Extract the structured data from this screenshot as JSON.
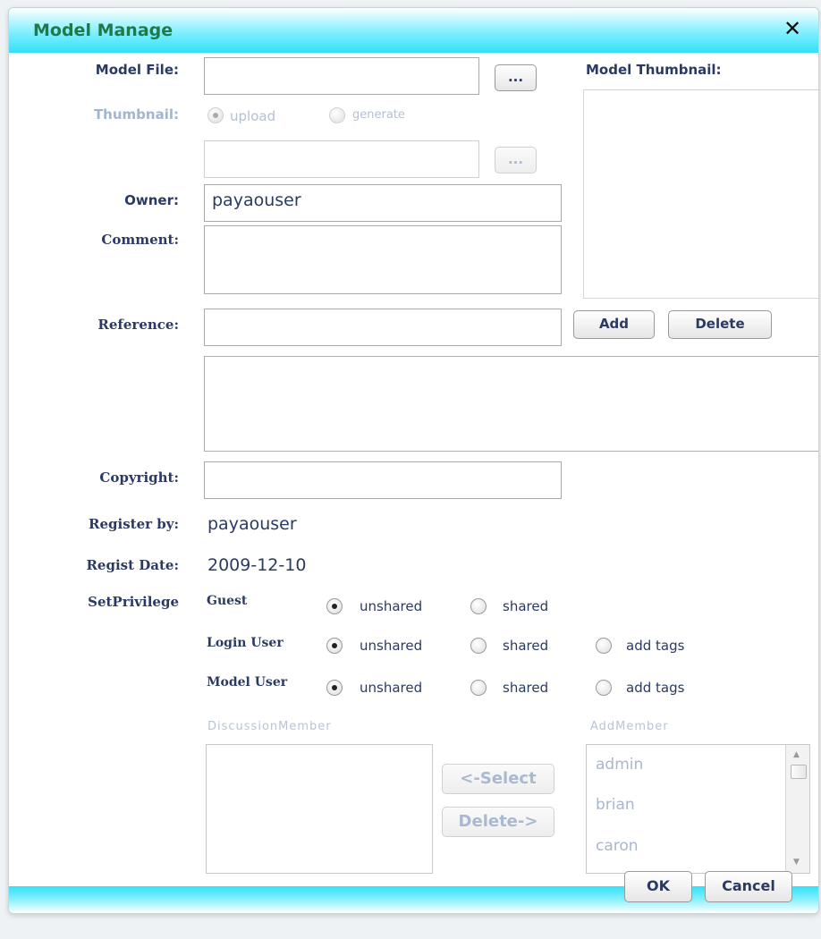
{
  "dialog": {
    "title": "Model Manage",
    "close_icon": "close-icon"
  },
  "model_file": {
    "label": "Model File:",
    "value": "",
    "browse_label": "..."
  },
  "thumbnail": {
    "label": "Thumbnail:",
    "options": [
      {
        "label": "upload",
        "checked": true
      },
      {
        "label": "generate",
        "checked": false
      }
    ],
    "file_value": "",
    "browse_label": "..."
  },
  "model_thumbnail": {
    "label": "Model Thumbnail:"
  },
  "owner": {
    "label": "Owner:",
    "value": "payaouser"
  },
  "comment": {
    "label": "Comment:",
    "value": ""
  },
  "reference": {
    "label": "Reference:",
    "value": "",
    "add_label": "Add",
    "delete_label": "Delete"
  },
  "copyright": {
    "label": "Copyright:",
    "value": ""
  },
  "register_by": {
    "label": "Register by:",
    "value": "payaouser"
  },
  "regist_date": {
    "label": "Regist Date:",
    "value": "2009-12-10"
  },
  "privilege": {
    "label": "SetPrivilege",
    "rows": [
      {
        "name": "Guest",
        "options": [
          {
            "label": "unshared",
            "checked": true
          },
          {
            "label": "shared",
            "checked": false
          }
        ]
      },
      {
        "name": "Login User",
        "options": [
          {
            "label": "unshared",
            "checked": true
          },
          {
            "label": "shared",
            "checked": false
          },
          {
            "label": "add tags",
            "checked": false
          }
        ]
      },
      {
        "name": "Model User",
        "options": [
          {
            "label": "unshared",
            "checked": true
          },
          {
            "label": "shared",
            "checked": false
          },
          {
            "label": "add tags",
            "checked": false
          }
        ]
      }
    ]
  },
  "members": {
    "discussion_label": "DiscussionMember",
    "add_label": "AddMember",
    "discussion_items": [],
    "add_items": [
      "admin",
      "brian",
      "caron"
    ],
    "select_label": "<-Select",
    "delete_label": "Delete->"
  },
  "footer": {
    "ok_label": "OK",
    "cancel_label": "Cancel"
  }
}
